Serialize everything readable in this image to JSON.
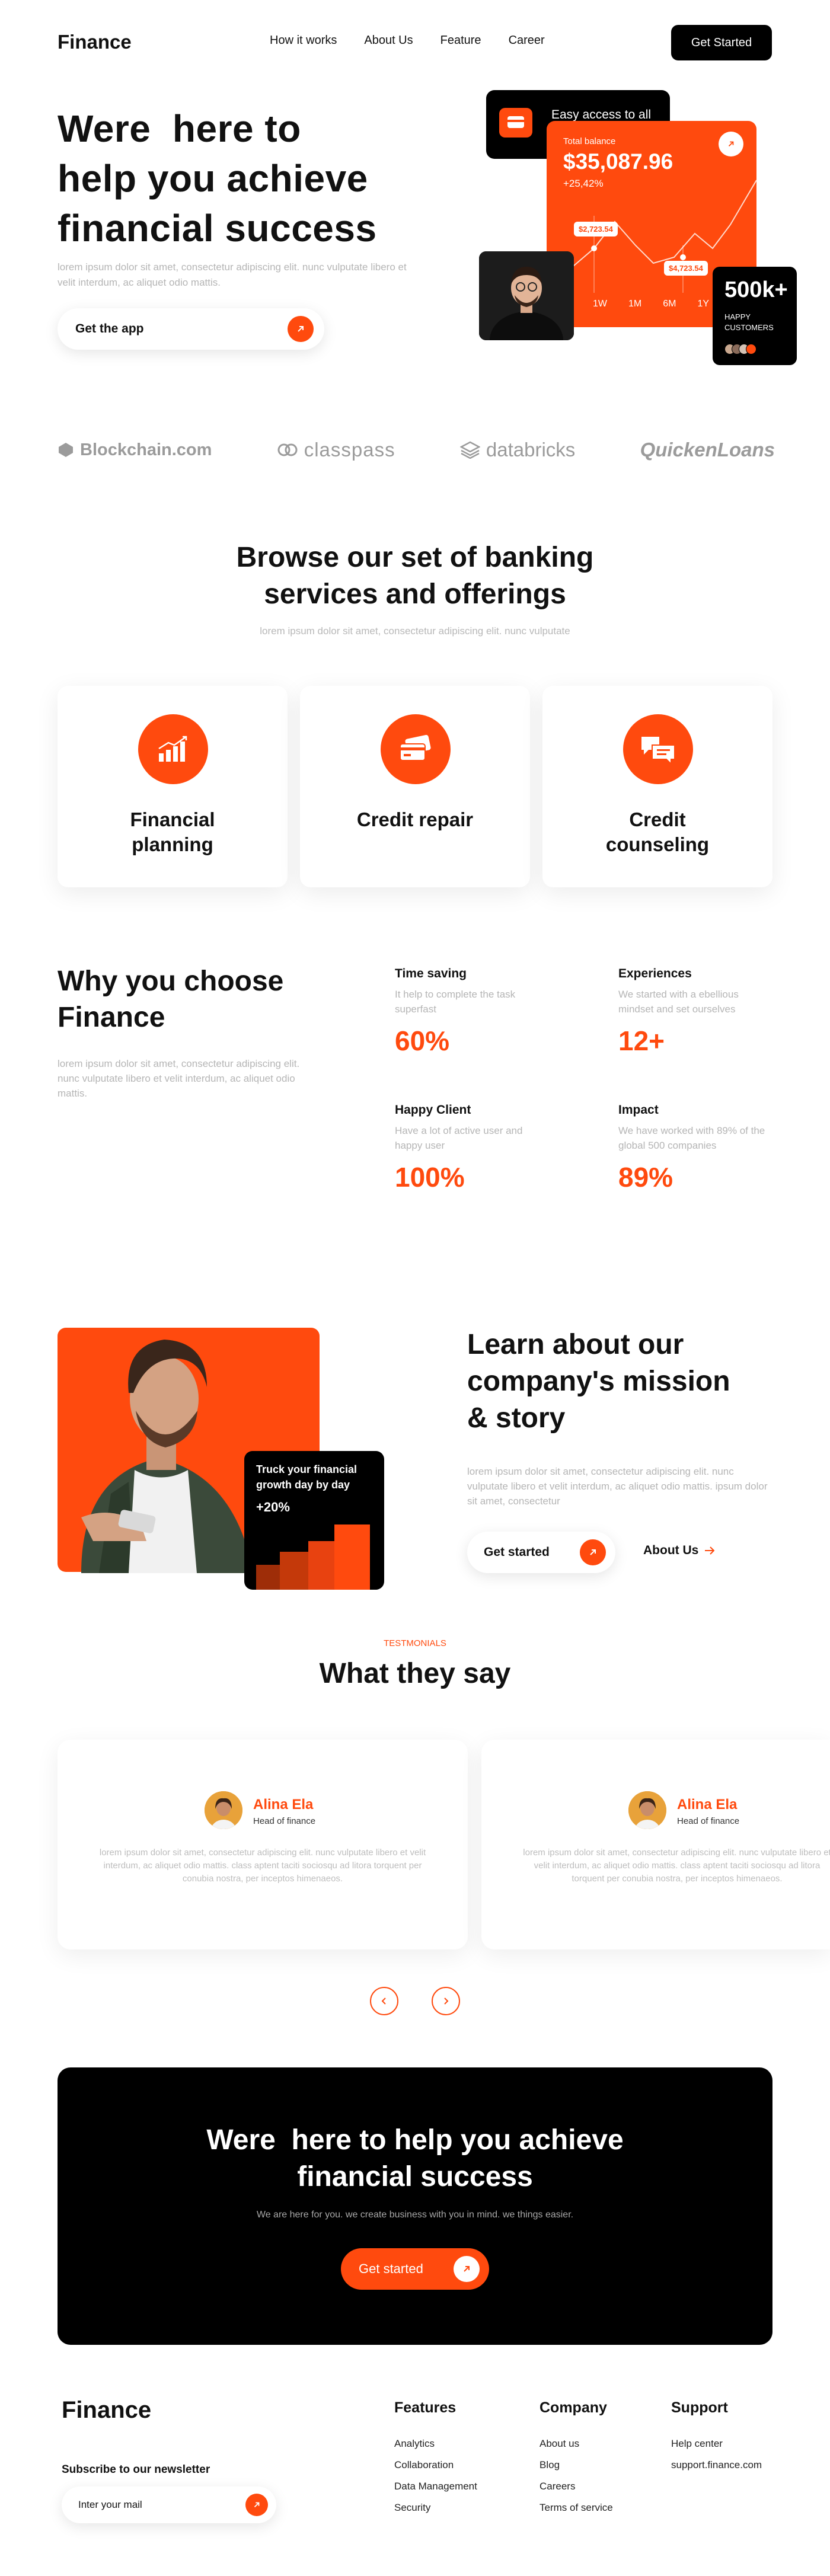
{
  "nav": {
    "logo": "Finance",
    "links": [
      "How it works",
      "About Us",
      "Feature",
      "Career"
    ],
    "cta": "Get Started"
  },
  "hero": {
    "title_line1": "Were  here to",
    "title_line2": "help you achieve",
    "title_line3": "financial success",
    "subtitle": "lorem ipsum dolor sit amet, consectetur adipiscing elit. nunc vulputate libero et velit interdum, ac aliquet odio mattis.",
    "app_button": "Get the app",
    "access_label": "Easy access to all",
    "balance_label": "Total balance",
    "balance_amount": "$35,087.96",
    "balance_change": "+25,42%",
    "tag_left": "$2,723.54",
    "tag_right": "$4,723.54",
    "periods": [
      "1W",
      "1M",
      "6M",
      "1Y"
    ],
    "customers_value": "500k+",
    "customers_label_line1": "HAPPY",
    "customers_label_line2": "CUSTOMERS"
  },
  "logos": [
    "Blockchain.com",
    "classpass",
    "databricks",
    "QuickenLoans"
  ],
  "services": {
    "title_line1": "Browse our set of banking",
    "title_line2": "services and offerings",
    "subtitle": "lorem ipsum dolor sit amet, consectetur adipiscing elit. nunc vulputate",
    "items": [
      {
        "line1": "Financial",
        "line2": "planning",
        "icon": "chart-icon"
      },
      {
        "line1": "Credit repair",
        "line2": "",
        "icon": "credit-card-icon"
      },
      {
        "line1": "Credit",
        "line2": "counseling",
        "icon": "chat-icon"
      }
    ]
  },
  "why": {
    "title_line1": "Why you choose",
    "title_line2": "Finance",
    "subtitle": "lorem ipsum dolor sit amet, consectetur adipiscing elit. nunc vulputate libero et velit interdum, ac aliquet odio mattis.",
    "stats": [
      {
        "title": "Time saving",
        "desc": "It help to complete the task superfast",
        "value": "60%"
      },
      {
        "title": "Experiences",
        "desc": "We started with a ebellious mindset and set ourselves",
        "value": "12+"
      },
      {
        "title": "Happy Client",
        "desc": "Have a lot of active user and happy user",
        "value": "100%"
      },
      {
        "title": "Impact",
        "desc": "We have worked with 89% of the global 500 companies",
        "value": "89%"
      }
    ]
  },
  "mission": {
    "title_line1": "Learn about our",
    "title_line2": "company's mission",
    "title_line3": "& story",
    "subtitle": "lorem ipsum dolor sit amet, consectetur adipiscing elit. nunc vulputate libero et velit interdum, ac aliquet odio mattis. ipsum dolor sit amet, consectetur",
    "cta": "Get started",
    "link": "About Us",
    "card_title_line1": "Truck your financial",
    "card_title_line2": "growth day by day",
    "card_value": "+20%"
  },
  "testimonials": {
    "tag": "TESTMONIALS",
    "title": "What they say",
    "items": [
      {
        "name": "Alina Ela",
        "role": "Head of finance",
        "quote": "lorem ipsum dolor sit amet, consectetur adipiscing elit. nunc vulputate libero et velit interdum, ac aliquet odio mattis. class aptent taciti sociosqu ad litora torquent per conubia nostra, per inceptos himenaeos."
      },
      {
        "name": "Alina Ela",
        "role": "Head of finance",
        "quote": "lorem ipsum dolor sit amet, consectetur adipiscing elit. nunc vulputate libero et velit interdum, ac aliquet odio mattis. class aptent taciti sociosqu ad litora torquent per conubia nostra, per inceptos himenaeos."
      }
    ]
  },
  "cta": {
    "title_line1": "Were  here to help you achieve",
    "title_line2": "financial success",
    "subtitle": "We are here for you. we create business with you in mind. we things easier.",
    "button": "Get started"
  },
  "footer": {
    "logo": "Finance",
    "newsletter_label": "Subscribe to our newsletter",
    "newsletter_placeholder": "Inter your mail",
    "columns": [
      {
        "title": "Features",
        "items": [
          "Analytics",
          "Collaboration",
          "Data Management",
          "Security"
        ]
      },
      {
        "title": "Company",
        "items": [
          "About us",
          "Blog",
          "Careers",
          "Terms of service"
        ]
      },
      {
        "title": "Support",
        "items": [
          "Help center",
          "support.finance.com"
        ]
      }
    ]
  },
  "colors": {
    "accent": "#FF4A0E",
    "dark": "#000000"
  }
}
